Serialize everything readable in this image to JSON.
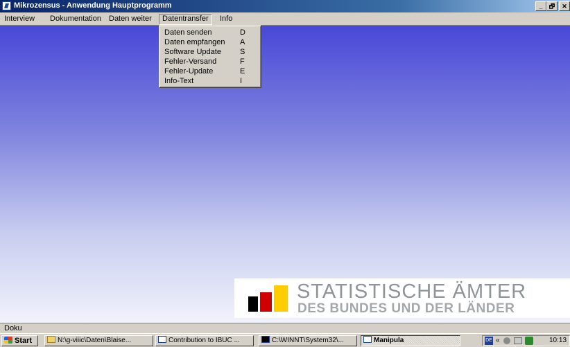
{
  "window": {
    "title": "Mikrozensus - Anwendung Hauptprogramm",
    "controls": [
      "_",
      "🗗",
      "✕"
    ]
  },
  "menubar": {
    "items": [
      "Interview",
      "Dokumentation",
      "Daten weiter",
      "Datentransfer",
      "Info"
    ],
    "active": "Datentransfer"
  },
  "dropdown": {
    "items": [
      {
        "label": "Daten senden",
        "key": "D"
      },
      {
        "label": "Daten empfangen",
        "key": "A"
      },
      {
        "label": "Software Update",
        "key": "S"
      },
      {
        "label": "Fehler-Versand",
        "key": "F"
      },
      {
        "label": "Fehler-Update",
        "key": "E"
      },
      {
        "label": "Info-Text",
        "key": "I"
      }
    ]
  },
  "logo": {
    "line1": "STATISTISCHE ÄMTER",
    "line2": "DES BUNDES UND DER LÄNDER",
    "colors": {
      "black": "#000000",
      "red": "#d00000",
      "yellow": "#ffcc00"
    }
  },
  "statusbar": {
    "text": "Doku"
  },
  "taskbar": {
    "start_label": "Start",
    "tasks": [
      {
        "label": "N:\\g-viiic\\Daten\\Blaise...",
        "icon": "folder-icon"
      },
      {
        "label": "Contribution to IBUC ...",
        "icon": "word-document-icon"
      },
      {
        "label": "C:\\WINNT\\System32\\...",
        "icon": "command-prompt-icon"
      },
      {
        "label": "Manipula",
        "icon": "app-icon",
        "pressed": true
      }
    ],
    "tray": {
      "lang": "DE",
      "chevron": "«",
      "clock": "10:13"
    }
  },
  "colors": {
    "title_start": "#0a246a",
    "title_end": "#a6caf0",
    "desktop_top": "#4848d8",
    "desktop_bottom": "#f1f2fb"
  }
}
